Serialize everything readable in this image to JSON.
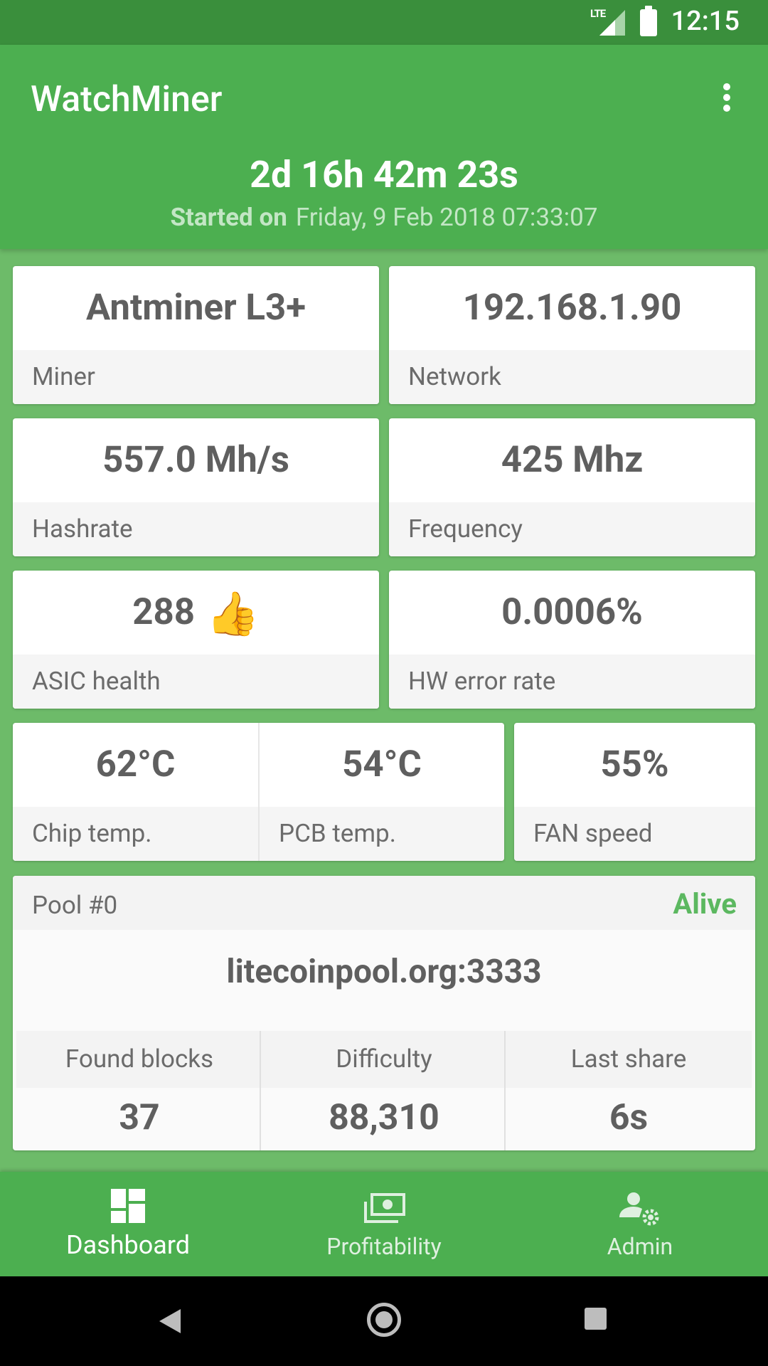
{
  "status_bar": {
    "network": "LTE",
    "time": "12:15"
  },
  "app_bar": {
    "title": "WatchMiner",
    "uptime": "2d 16h 42m 23s",
    "started_label": "Started on",
    "started_value": "Friday, 9 Feb 2018 07:33:07"
  },
  "cards": {
    "miner": {
      "value": "Antminer L3+",
      "label": "Miner"
    },
    "network": {
      "value": "192.168.1.90",
      "label": "Network"
    },
    "hashrate": {
      "value": "557.0 Mh/s",
      "label": "Hashrate"
    },
    "frequency": {
      "value": "425 Mhz",
      "label": "Frequency"
    },
    "asic_health": {
      "value": "288",
      "emoji": "👍",
      "label": "ASIC health"
    },
    "hw_error_rate": {
      "value": "0.0006%",
      "label": "HW error rate"
    },
    "chip_temp": {
      "value": "62°C",
      "label": "Chip temp."
    },
    "pcb_temp": {
      "value": "54°C",
      "label": "PCB temp."
    },
    "fan_speed": {
      "value": "55%",
      "label": "FAN speed"
    }
  },
  "pool": {
    "name": "Pool #0",
    "status": "Alive",
    "url": "litecoinpool.org:3333",
    "stats": [
      {
        "label": "Found blocks",
        "value": "37"
      },
      {
        "label": "Difficulty",
        "value": "88,310"
      },
      {
        "label": "Last share",
        "value": "6s"
      }
    ]
  },
  "bottom_nav": {
    "items": [
      {
        "label": "Dashboard",
        "icon": "dashboard-icon",
        "active": true
      },
      {
        "label": "Profitability",
        "icon": "money-icon",
        "active": false
      },
      {
        "label": "Admin",
        "icon": "admin-settings-icon",
        "active": false
      }
    ]
  },
  "colors": {
    "primary": "#4caf50",
    "primary_dark": "#3a8f3c",
    "background": "#6dbb69",
    "alive": "#5cb860"
  }
}
